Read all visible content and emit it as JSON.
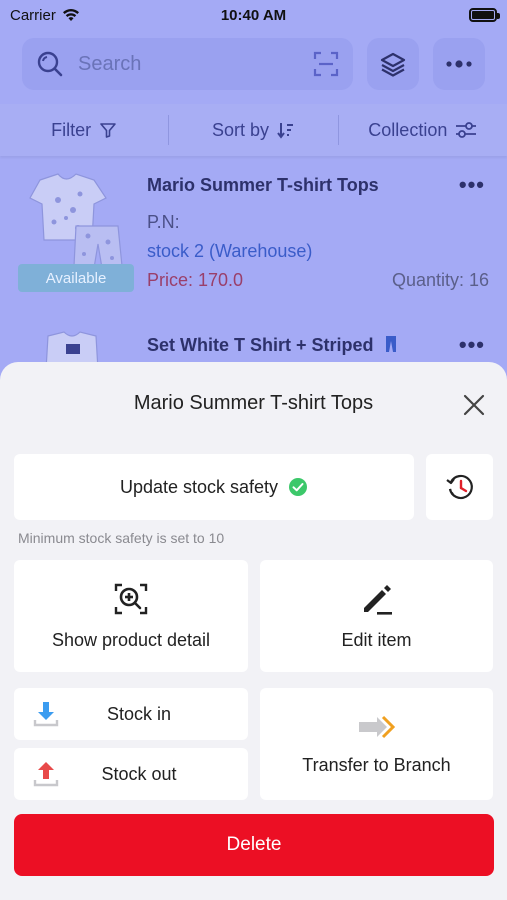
{
  "status": {
    "carrier": "Carrier",
    "time": "10:40 AM"
  },
  "search": {
    "placeholder": "Search"
  },
  "filters": {
    "filter_label": "Filter",
    "sort_label": "Sort by",
    "collection_label": "Collection"
  },
  "products": [
    {
      "title": "Mario Summer T-shirt Tops",
      "badge": "Available",
      "pn": "P.N:",
      "stock": "stock 2 (Warehouse)",
      "price": "Price: 170.0",
      "quantity": "Quantity: 16"
    },
    {
      "title": "Set White T Shirt + Striped"
    }
  ],
  "sheet": {
    "title": "Mario Summer T-shirt Tops",
    "update_stock_safety": "Update stock safety",
    "hint": "Minimum stock safety is set to 10",
    "show_product_detail": "Show product detail",
    "edit_item": "Edit item",
    "stock_in": "Stock in",
    "stock_out": "Stock out",
    "transfer_to_branch": "Transfer to Branch",
    "delete": "Delete"
  },
  "colors": {
    "accent": "#a4aaf5",
    "delete": "#ec0f24",
    "check": "#3cc86a",
    "history": "#e0202a"
  }
}
